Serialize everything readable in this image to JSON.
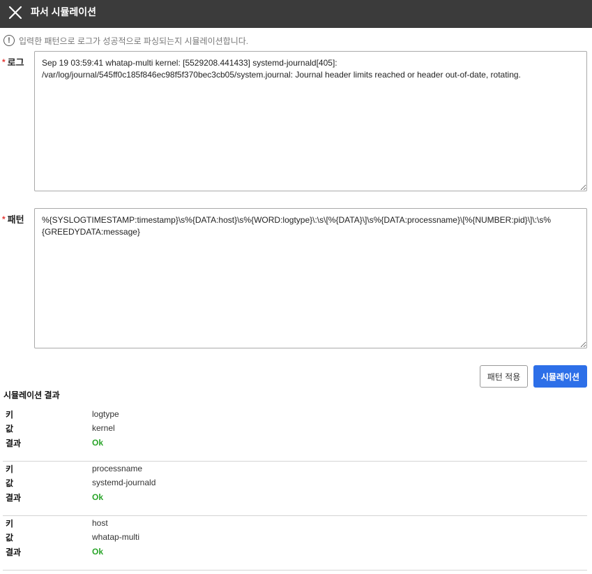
{
  "header": {
    "title": "파서 시뮬레이션",
    "close_icon": "close-icon"
  },
  "info": {
    "icon": "info-circle-icon",
    "glyph": "!",
    "text": "입력한 패턴으로 로그가 성공적으로 파싱되는지 시뮬레이션합니다."
  },
  "log_field": {
    "required_mark": "*",
    "label": "로그",
    "value": "Sep 19 03:59:41 whatap-multi kernel: [5529208.441433] systemd-journald[405]: /var/log/journal/545ff0c185f846ec98f5f370bec3cb05/system.journal: Journal header limits reached or header out-of-date, rotating."
  },
  "pattern_field": {
    "required_mark": "*",
    "label": "패턴",
    "value": "%{SYSLOGTIMESTAMP:timestamp}\\s%{DATA:host}\\s%{WORD:logtype}\\:\\s\\[%{DATA}\\]\\s%{DATA:processname}\\[%{NUMBER:pid}\\]\\:\\s%{GREEDYDATA:message}"
  },
  "buttons": {
    "apply_label": "패턴 적용",
    "simulate_label": "시뮬레이션"
  },
  "results": {
    "title": "시뮬레이션 결과",
    "key_label": "키",
    "value_label": "값",
    "result_label": "결과",
    "status_color": "#2aa52a",
    "items": [
      {
        "key": "logtype",
        "value": "kernel",
        "result": "Ok"
      },
      {
        "key": "processname",
        "value": "systemd-journald",
        "result": "Ok"
      },
      {
        "key": "host",
        "value": "whatap-multi",
        "result": "Ok"
      }
    ]
  }
}
